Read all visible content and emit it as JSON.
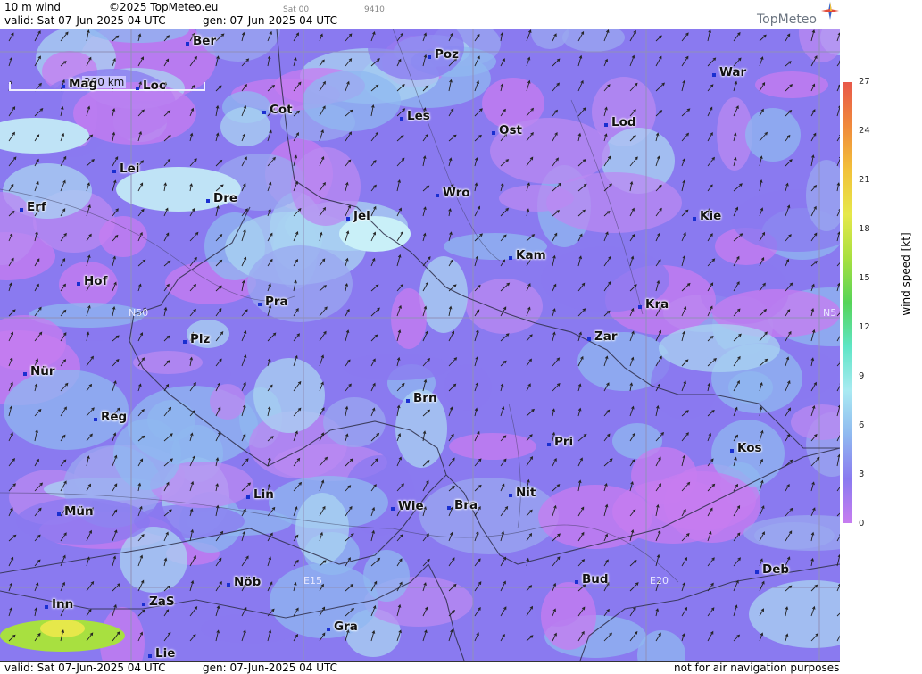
{
  "header": {
    "product": "10 m wind",
    "copyright": "©2025 TopMeteo.eu",
    "faint_a": "Sat 00",
    "faint_b": "9410",
    "valid": "valid:  Sat  07-Jun-2025  04 UTC",
    "generated": "gen: 07-Jun-2025 04 UTC",
    "logo": "TopMeteo"
  },
  "footer": {
    "valid": "valid:  Sat  07-Jun-2025  04 UTC",
    "generated": "gen: 07-Jun-2025 04 UTC",
    "disclaimer": "not for air navigation purposes"
  },
  "scale_bar": "200 km",
  "grid_labels": {
    "n50_left": "N50",
    "n50_right": "N5",
    "e15": "E15",
    "e20": "E20"
  },
  "cities": [
    "Ber",
    "Poz",
    "War",
    "Mag",
    "Loc",
    "Cot",
    "Les",
    "Lod",
    "Ost",
    "Lei",
    "Erf",
    "Dre",
    "Jel",
    "Wro",
    "Kie",
    "Kam",
    "Hof",
    "Pra",
    "Kra",
    "N50",
    "Zar",
    "Plz",
    "Nür",
    "Brn",
    "Reg",
    "Pri",
    "Kos",
    "Lin",
    "Nit",
    "Wie",
    "Bra",
    "Mün",
    "Deb",
    "Nöb",
    "Bud",
    "Inn",
    "ZaS",
    "Gra",
    "Lie"
  ],
  "legend": {
    "title": "wind  speed  [kt]",
    "ticks": [
      "27",
      "24",
      "21",
      "18",
      "15",
      "12",
      "9",
      "6",
      "3",
      "0"
    ],
    "colors": [
      "#e8584a",
      "#f08a3c",
      "#f2c23a",
      "#e6e84a",
      "#a8e040",
      "#56d458",
      "#5fe6c6",
      "#a9eaf2",
      "#8fb8f0",
      "#8a7af0",
      "#c77cf0"
    ]
  }
}
